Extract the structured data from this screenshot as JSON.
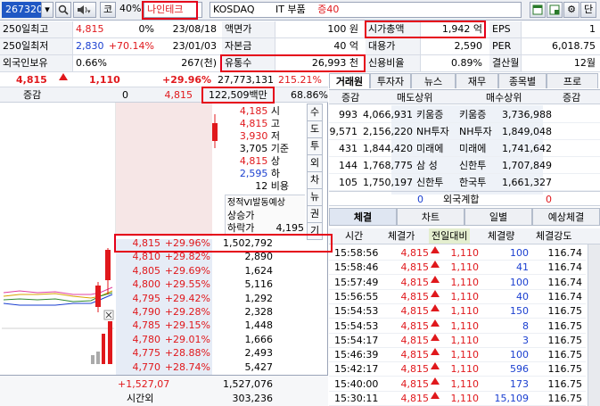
{
  "toolbar": {
    "code": "267320",
    "market_mark": "코",
    "margin_rate": "40%",
    "stock_name": "나인테크",
    "market": "KOSDAQ",
    "sector": "IT 부품",
    "deposit": "증40",
    "buttons": {
      "single": "단"
    }
  },
  "info": {
    "row1": {
      "l1": "250일최고",
      "v1": "4,815",
      "p1": "0%",
      "d1": "23/08/18",
      "l2": "액면가",
      "v2": "100 원",
      "l3": "시가총액",
      "v3": "1,942 억",
      "l4": "EPS",
      "v4": "1"
    },
    "row2": {
      "l1": "250일최저",
      "v1": "2,830",
      "p1": "+70.14%",
      "d1": "23/01/03",
      "l2": "자본금",
      "v2": "40 억",
      "l3": "대용가",
      "v3": "2,590",
      "l4": "PER",
      "v4": "6,018.75"
    },
    "row3": {
      "l1": "외국인보유",
      "v1": "0.66%",
      "v1b": "267(천)",
      "l2": "유통수",
      "v2": "26,993 천",
      "l3": "신용비율",
      "v3": "0.89%",
      "l4": "결산월",
      "v4": "12월"
    }
  },
  "price": {
    "current": "4,815",
    "change": "1,110",
    "rate": "+29.96%",
    "volume": "27,773,131",
    "vol_rate": "215.21%"
  },
  "orderbook": {
    "header_label": "증감",
    "header_value": "0",
    "header_price": "4,815",
    "trade_value": "122,509백만",
    "strength": "68.86%",
    "ask_info": [
      {
        "v": "4,185",
        "k": "시"
      },
      {
        "v": "4,815",
        "k": "고"
      },
      {
        "v": "3,930",
        "k": "저"
      },
      {
        "v": "3,705",
        "k": "기준"
      },
      {
        "v": "4,815",
        "k": "상"
      },
      {
        "v": "2,595",
        "k": "하"
      },
      {
        "v": "12",
        "k": "비용"
      }
    ],
    "vi_label": "정적VI발동예상",
    "vi_up": "상승가",
    "vi_down": "하락가",
    "vi_down_value": "4,195",
    "side_buttons": [
      "수",
      "도",
      "투",
      "외",
      "차",
      "뉴",
      "권",
      "기"
    ],
    "bids": [
      {
        "price": "4,815",
        "rate": "+29.96%",
        "qty": "1,502,792"
      },
      {
        "price": "4,810",
        "rate": "+29.82%",
        "qty": "2,890"
      },
      {
        "price": "4,805",
        "rate": "+29.69%",
        "qty": "1,624"
      },
      {
        "price": "4,800",
        "rate": "+29.55%",
        "qty": "5,116"
      },
      {
        "price": "4,795",
        "rate": "+29.42%",
        "qty": "1,292"
      },
      {
        "price": "4,790",
        "rate": "+29.28%",
        "qty": "2,328"
      },
      {
        "price": "4,785",
        "rate": "+29.15%",
        "qty": "1,448"
      },
      {
        "price": "4,780",
        "rate": "+29.01%",
        "qty": "1,666"
      },
      {
        "price": "4,775",
        "rate": "+28.88%",
        "qty": "2,493"
      },
      {
        "price": "4,770",
        "rate": "+28.74%",
        "qty": "5,427"
      }
    ],
    "total_diff": "+1,527,07",
    "total_bid": "1,527,076",
    "after_hours_label": "시간외",
    "after_hours_value": "303,236"
  },
  "right_panel": {
    "tabs": [
      "거래원",
      "투자자",
      "뉴스",
      "재무",
      "종목별",
      "프로"
    ],
    "broker_headers": {
      "delta": "증감",
      "sell_top": "매도상위",
      "buy_top": "매수상위",
      "delta2": "증감"
    },
    "brokers": [
      {
        "sd": "993",
        "sq": "4,066,931",
        "sn": "키움증",
        "bn": "키움증",
        "bq": "3,736,988"
      },
      {
        "sd": "9,571",
        "sq": "2,156,220",
        "sn": "NH투자",
        "bn": "NH투자",
        "bq": "1,849,048"
      },
      {
        "sd": "431",
        "sq": "1,844,420",
        "sn": "미래에",
        "bn": "미래에",
        "bq": "1,741,642"
      },
      {
        "sd": "144",
        "sq": "1,768,775",
        "sn": "삼 성",
        "bn": "신한투",
        "bq": "1,707,849"
      },
      {
        "sd": "105",
        "sq": "1,750,197",
        "sn": "신한투",
        "bn": "한국투",
        "bq": "1,661,327"
      }
    ],
    "foreign": {
      "left": "0",
      "label": "외국계합",
      "right": "0"
    },
    "tabs2": [
      "체결",
      "차트",
      "일별",
      "예상체결"
    ],
    "trade_headers": {
      "time": "시간",
      "price": "체결가",
      "diff": "전일대비",
      "qty": "체결량",
      "strength": "체결강도"
    },
    "trades": [
      {
        "time": "15:58:56",
        "price": "4,815",
        "diff": "1,110",
        "qty": "100",
        "str": "116.74"
      },
      {
        "time": "15:58:46",
        "price": "4,815",
        "diff": "1,110",
        "qty": "41",
        "str": "116.74"
      },
      {
        "time": "15:57:49",
        "price": "4,815",
        "diff": "1,110",
        "qty": "100",
        "str": "116.74"
      },
      {
        "time": "15:56:55",
        "price": "4,815",
        "diff": "1,110",
        "qty": "40",
        "str": "116.74"
      },
      {
        "time": "15:54:53",
        "price": "4,815",
        "diff": "1,110",
        "qty": "150",
        "str": "116.75"
      },
      {
        "time": "15:54:53",
        "price": "4,815",
        "diff": "1,110",
        "qty": "8",
        "str": "116.75"
      },
      {
        "time": "15:54:17",
        "price": "4,815",
        "diff": "1,110",
        "qty": "3",
        "str": "116.75"
      },
      {
        "time": "15:46:39",
        "price": "4,815",
        "diff": "1,110",
        "qty": "100",
        "str": "116.75"
      },
      {
        "time": "15:42:17",
        "price": "4,815",
        "diff": "1,110",
        "qty": "596",
        "str": "116.75"
      },
      {
        "time": "15:40:00",
        "price": "4,815",
        "diff": "1,110",
        "qty": "173",
        "str": "116.75"
      },
      {
        "time": "15:30:11",
        "price": "4,815",
        "diff": "1,110",
        "qty": "15,109",
        "str": "116.75"
      }
    ]
  },
  "colors": {
    "up": "#e0181c",
    "down": "#1a3fd0",
    "highlight": "#e5001a"
  }
}
